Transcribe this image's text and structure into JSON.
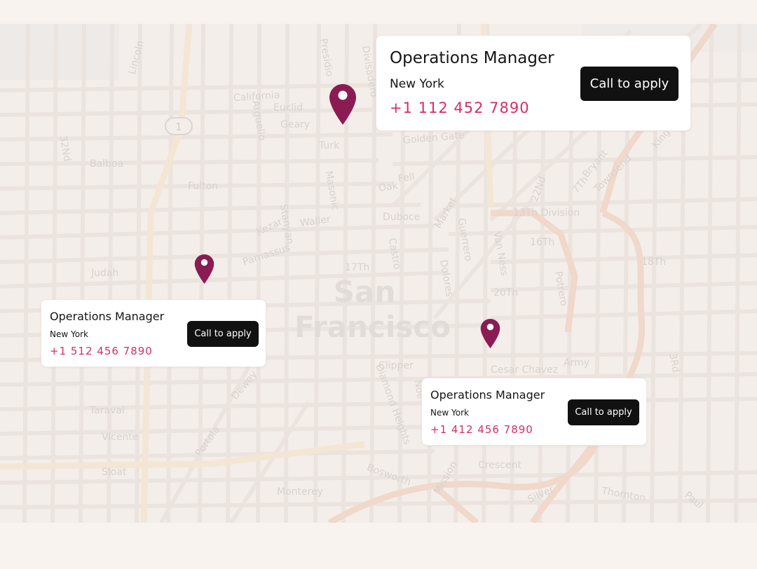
{
  "map": {
    "city_label_line1": "San",
    "city_label_line2": "Francisco",
    "highway_shield": "1",
    "streets": {
      "lincoln": "Lincoln",
      "presidio": "Presidio",
      "divisadero": "Divisadero",
      "california": "California",
      "euclid": "Euclid",
      "arguello": "Arguello",
      "geary": "Geary",
      "turk": "Turk",
      "golden_gate": "Golden Gate",
      "balboa": "Balboa",
      "fulton": "Fulton",
      "fell": "Fell",
      "oak": "Oak",
      "duboce": "Duboce",
      "market": "Market",
      "kezar": "Kezar",
      "waller": "Waller",
      "stanyan": "Stanyan",
      "masonic": "Masonic",
      "parnassus": "Parnassus",
      "judah": "Judah",
      "seventeenth": "17Th",
      "castro": "Castro",
      "dolores": "Dolores",
      "guerrero": "Guerrero",
      "van_ness": "Van Ness",
      "thirteenth_division": "13Th Division",
      "sixteenth": "16Th",
      "potrero": "Potrero",
      "eighteenth": "18Th",
      "twentieth": "20Th",
      "cesar_chavez": "Cesar Chavez",
      "army": "Army",
      "clipper": "Clipper",
      "diamond_heights": "Diamond Heights",
      "noe": "Noe",
      "taraval": "Taraval",
      "vicente": "Vicente",
      "sloat": "Sloat",
      "dewey": "Dewey",
      "portola": "Portola",
      "bosworth": "Bosworth",
      "crescent": "Crescent",
      "mission": "Mission",
      "monterey": "Monterey",
      "silver": "Silver",
      "thornton": "Thornton",
      "paul": "Paul",
      "third": "3Rd",
      "king": "King",
      "townsend": "Townsend",
      "bryant": "Bryant",
      "seventh": "7Th",
      "twenty_second": "22Nd",
      "thirty_second": "32Nd"
    }
  },
  "pins": [
    {
      "name": "pin-1",
      "color": "#8a1c53"
    },
    {
      "name": "pin-2",
      "color": "#8a1c53"
    },
    {
      "name": "pin-3",
      "color": "#8a1c53"
    }
  ],
  "listings": [
    {
      "title": "Operations Manager",
      "location": "New York",
      "phone": "+1 112 452 7890",
      "cta": "Call to apply"
    },
    {
      "title": "Operations Manager",
      "location": "New York",
      "phone": "+1 512 456 7890",
      "cta": "Call to apply"
    },
    {
      "title": "Operations Manager",
      "location": "New York",
      "phone": "+1 412 456 7890",
      "cta": "Call to apply"
    }
  ],
  "colors": {
    "page_background": "#f8f3ef",
    "map_background": "#f4eeea",
    "street": "#ebe4df",
    "highway": "#f3e6d4",
    "major_road": "#f0d2c2",
    "pin": "#8a1c53",
    "phone_text": "#d62d67",
    "button_bg": "#111111",
    "button_text": "#ffffff"
  }
}
